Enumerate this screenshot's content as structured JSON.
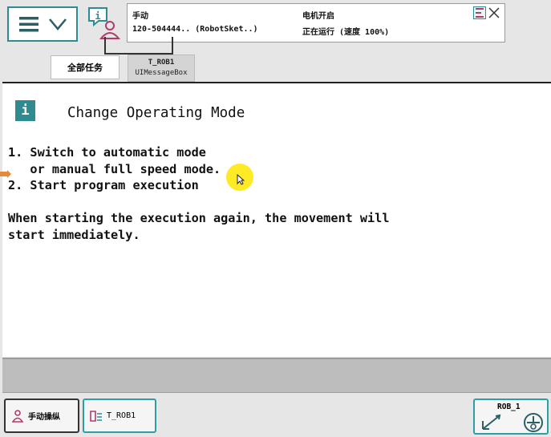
{
  "header": {
    "menu_icon": "hamburger-menu-icon",
    "menu_chevron_icon": "chevron-down-icon",
    "info_icon": "info-person-icon",
    "mode": "手动",
    "controller": "120-504444.. (RobotSket..)",
    "motor_state": "电机开启",
    "run_state": "正在运行 (速度 100%)",
    "status_icons": [
      "program-state-icon",
      "close-icon"
    ]
  },
  "tabs": {
    "all_tasks": "全部任务",
    "active_title": "T_ROB1",
    "active_subtitle": "UIMessageBox"
  },
  "message": {
    "icon_letter": "i",
    "title": "Change Operating Mode",
    "lines": [
      "1. Switch to automatic mode",
      "   or manual full speed mode.",
      "2. Start program execution",
      "",
      "When starting the execution again, the movement will",
      "start immediately."
    ]
  },
  "footer": {
    "manual_button": "手动操纵",
    "trob_button": "T_ROB1",
    "rob_label": "ROB_1"
  },
  "colors": {
    "accent": "#2c8c91",
    "highlight": "#ffe600",
    "pointer": "#e58a3a"
  }
}
